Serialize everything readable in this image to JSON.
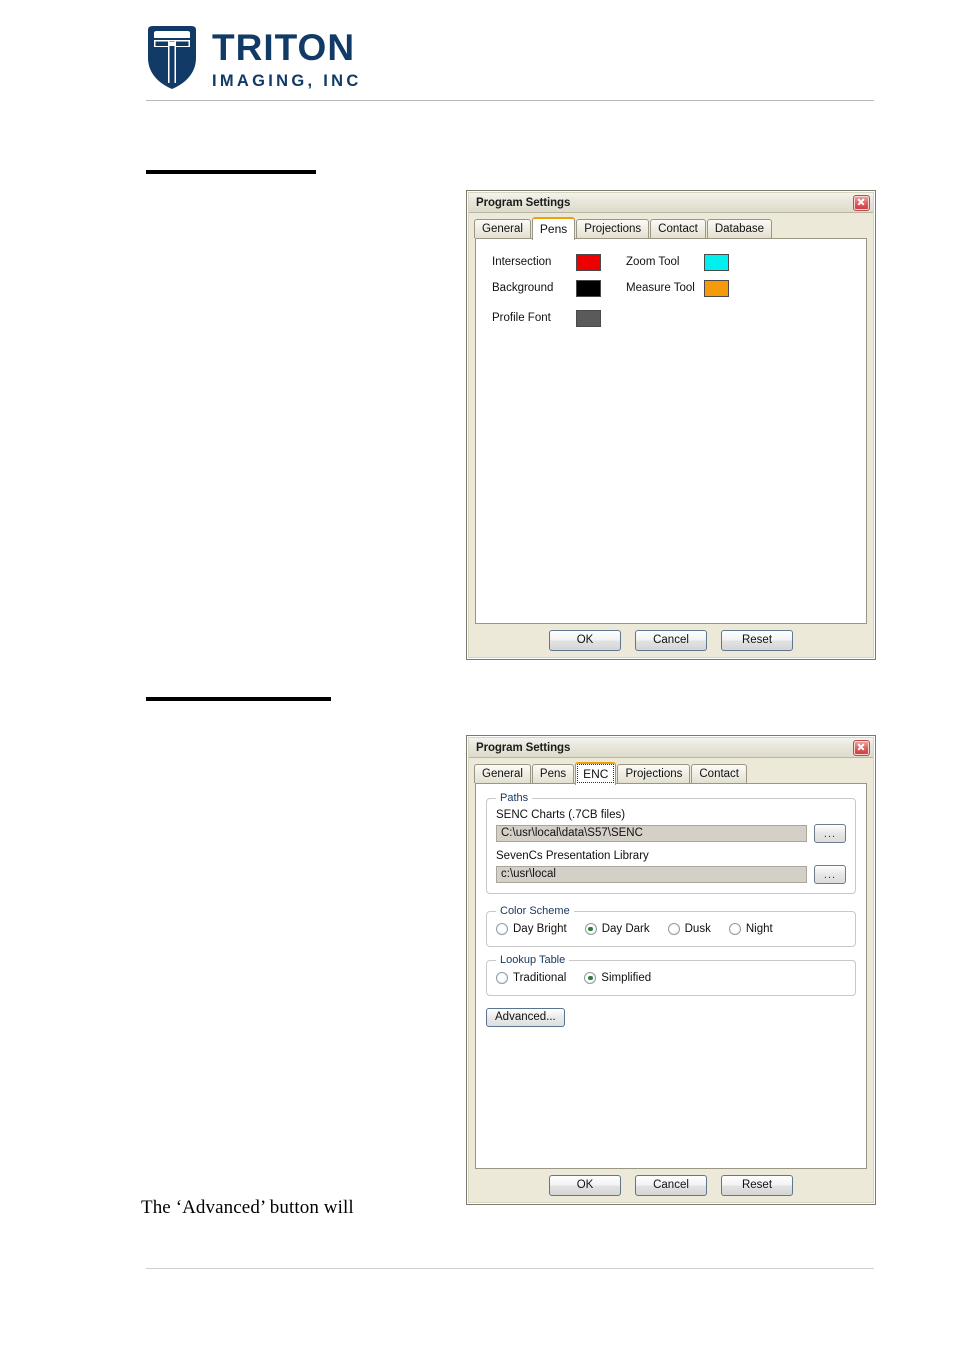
{
  "header": {
    "brand_line1": "TRITON",
    "brand_line2": "IMAGING, INC",
    "brand_color": "#123A66",
    "logo_icon": "triton-shield-logo"
  },
  "body": {
    "paragraph": "The ‘Advanced’ button will"
  },
  "dialog_pens": {
    "title": "Program Settings",
    "close_label": "×",
    "tabs": [
      {
        "label": "General",
        "active": false
      },
      {
        "label": "Pens",
        "active": true
      },
      {
        "label": "Projections",
        "active": false
      },
      {
        "label": "Contact",
        "active": false
      },
      {
        "label": "Database",
        "active": false
      }
    ],
    "pens_left": [
      {
        "label": "Intersection",
        "color": "#EE0000"
      },
      {
        "label": "Background",
        "color": "#000000"
      },
      {
        "label": "Profile Font",
        "color": "#5A5A5A"
      }
    ],
    "pens_right": [
      {
        "label": "Zoom Tool",
        "color": "#00F0F0"
      },
      {
        "label": "Measure Tool",
        "color": "#F59B0B"
      }
    ],
    "buttons": [
      {
        "label": "OK"
      },
      {
        "label": "Cancel"
      },
      {
        "label": "Reset"
      }
    ]
  },
  "dialog_enc": {
    "title": "Program Settings",
    "close_label": "×",
    "tabs": [
      {
        "label": "General",
        "active": false
      },
      {
        "label": "Pens",
        "active": false
      },
      {
        "label": "ENC",
        "active": true
      },
      {
        "label": "Projections",
        "active": false
      },
      {
        "label": "Contact",
        "active": false
      }
    ],
    "paths": {
      "group_title": "Paths",
      "senc_label": "SENC Charts (.7CB files)",
      "senc_value": "C:\\usr\\local\\data\\S57\\SENC",
      "senc_browse": "...",
      "library_label": "SevenCs Presentation Library",
      "library_value": "c:\\usr\\local",
      "library_browse": "..."
    },
    "color_scheme": {
      "group_title": "Color Scheme",
      "options": [
        {
          "label": "Day Bright",
          "checked": false
        },
        {
          "label": "Day Dark",
          "checked": true
        },
        {
          "label": "Dusk",
          "checked": false
        },
        {
          "label": "Night",
          "checked": false
        }
      ]
    },
    "lookup_table": {
      "group_title": "Lookup Table",
      "options": [
        {
          "label": "Traditional",
          "checked": false
        },
        {
          "label": "Simplified",
          "checked": true
        }
      ]
    },
    "advanced_button": "Advanced...",
    "buttons": [
      {
        "label": "OK"
      },
      {
        "label": "Cancel"
      },
      {
        "label": "Reset"
      }
    ]
  }
}
